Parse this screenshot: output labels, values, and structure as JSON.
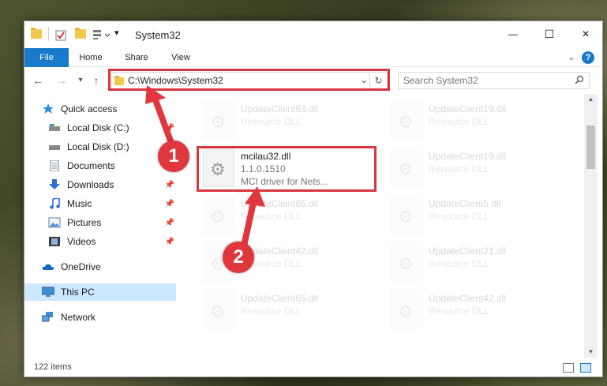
{
  "window": {
    "title": "System32",
    "controls": {
      "minimize": "—",
      "maximize": "☐",
      "close": "✕"
    }
  },
  "ribbon": {
    "tabs": [
      {
        "label": "File"
      },
      {
        "label": "Home"
      },
      {
        "label": "Share"
      },
      {
        "label": "View"
      }
    ],
    "expand": "⌄",
    "help": "?"
  },
  "address": {
    "path": "C:\\Windows\\System32",
    "dropdown": "⌄",
    "refresh": "↻"
  },
  "search": {
    "placeholder": "Search System32"
  },
  "sidebar": {
    "items": [
      {
        "label": "Quick access",
        "icon": "star-icon",
        "pinned": false
      },
      {
        "label": "Local Disk (C:)",
        "icon": "drive-icon",
        "pinned": true
      },
      {
        "label": "Local Disk (D:)",
        "icon": "drive-icon",
        "pinned": true
      },
      {
        "label": "Documents",
        "icon": "documents-icon",
        "pinned": true
      },
      {
        "label": "Downloads",
        "icon": "download-icon",
        "pinned": true
      },
      {
        "label": "Music",
        "icon": "music-icon",
        "pinned": true
      },
      {
        "label": "Pictures",
        "icon": "pictures-icon",
        "pinned": true
      },
      {
        "label": "Videos",
        "icon": "videos-icon",
        "pinned": true
      },
      {
        "label": "OneDrive",
        "icon": "cloud-icon",
        "pinned": false
      },
      {
        "label": "This PC",
        "icon": "computer-icon",
        "pinned": false,
        "selected": true
      },
      {
        "label": "Network",
        "icon": "network-icon",
        "pinned": false
      }
    ]
  },
  "files": {
    "left_column": [
      {
        "name": "UpdateClient63.dll",
        "line2": "Resource DLL",
        "faded": true
      },
      {
        "name": "mcilau32.dll",
        "line2": "1.1.0.1510",
        "line3": "MCI driver for Nets...",
        "faded": false
      },
      {
        "name": "UpdateClient65.dll",
        "line2": "Resource DLL",
        "faded": true
      },
      {
        "name": "UpdateClient42.dll",
        "line2": "Resource DLL",
        "faded": true
      },
      {
        "name": "UpdateClient65.dll",
        "line2": "Resource DLL",
        "faded": true
      }
    ],
    "right_column": [
      {
        "name": "UpdateClient19.dll",
        "line2": "Resource DLL",
        "faded": true
      },
      {
        "name": "UpdateClient19.dll",
        "line2": "Resource DLL",
        "faded": true
      },
      {
        "name": "UpdateClient5.dll",
        "line2": "Resource DLL",
        "faded": true
      },
      {
        "name": "UpdateClient21.dll",
        "line2": "Resource DLL",
        "faded": true
      },
      {
        "name": "UpdateClient42.dll",
        "line2": "Resource DLL",
        "faded": true
      }
    ]
  },
  "status": {
    "count": "122 items"
  },
  "annotations": {
    "step1": "1",
    "step2": "2",
    "color": "#e0363d"
  },
  "colors": {
    "accent": "#1979ca",
    "selection": "#cce8ff",
    "highlight": "#d9363e"
  }
}
